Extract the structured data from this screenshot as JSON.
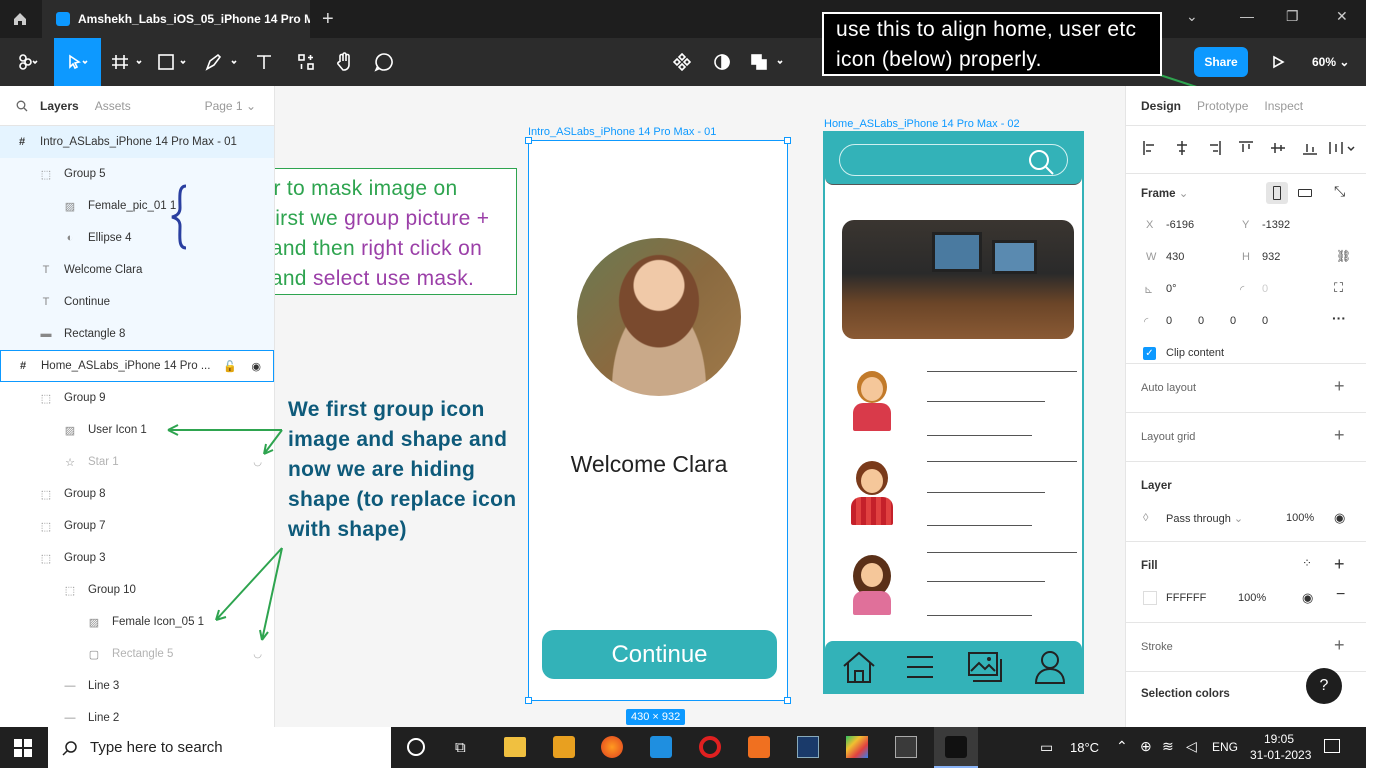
{
  "tabbar": {
    "file_tab": "Amshekh_Labs_iOS_05_iPhone 14 Pro M",
    "close": "✕",
    "new_tab": "+"
  },
  "toolbar": {
    "share_label": "Share",
    "zoom": "60%",
    "present_icon": "play-icon"
  },
  "left_panel": {
    "tabs": [
      "Layers",
      "Assets"
    ],
    "page_select": "Page 1",
    "layers": [
      {
        "name": "Intro_ASLabs_iPhone 14 Pro Max - 01",
        "icon": "frame-icon"
      },
      {
        "name": "Group 5",
        "icon": "group-icon"
      },
      {
        "name": "Female_pic_01 1",
        "icon": "image-icon"
      },
      {
        "name": "Ellipse 4",
        "icon": "mask-icon"
      },
      {
        "name": "Welcome Clara",
        "icon": "text-icon"
      },
      {
        "name": "Continue",
        "icon": "text-icon"
      },
      {
        "name": "Rectangle 8",
        "icon": "rectangle-icon"
      },
      {
        "name": "Home_ASLabs_iPhone 14 Pro ...",
        "icon": "frame-icon"
      },
      {
        "name": "Group 9",
        "icon": "group-icon"
      },
      {
        "name": "User Icon 1",
        "icon": "image-icon"
      },
      {
        "name": "Star 1",
        "icon": "star-icon"
      },
      {
        "name": "Group 8",
        "icon": "group-icon"
      },
      {
        "name": "Group 7",
        "icon": "group-icon"
      },
      {
        "name": "Group 3",
        "icon": "group-icon"
      },
      {
        "name": "Group 10",
        "icon": "group-icon"
      },
      {
        "name": "Female Icon_05 1",
        "icon": "image-icon"
      },
      {
        "name": "Rectangle 5",
        "icon": "rectangle-icon"
      },
      {
        "name": "Line 3",
        "icon": "line-icon"
      },
      {
        "name": "Line 2",
        "icon": "line-icon"
      }
    ]
  },
  "canvas": {
    "frame1_label": "Intro_ASLabs_iPhone 14 Pro Max - 01",
    "frame2_label": "Home_ASLabs_iPhone 14 Pro Max - 02",
    "welcome_text": "Welcome  Clara",
    "continue_label": "Continue",
    "size_badge": "430 × 932"
  },
  "annotations": {
    "top": "use this to align home, user etc icon (below) properly.",
    "mask": {
      "p1": "In order to mask image on circle, first we ",
      "h1": "group picture + shape",
      "p2": " and then ",
      "h2": "right click on shape",
      "p3": " and ",
      "h3": "select use mask."
    },
    "hiding": "We first group icon image and shape and now we are hiding shape (to replace icon with shape)"
  },
  "right_panel": {
    "tabs": [
      "Design",
      "Prototype",
      "Inspect"
    ],
    "frame_label": "Frame",
    "x_label": "X",
    "x": "-6196",
    "y_label": "Y",
    "y": "-1392",
    "w_label": "W",
    "w": "430",
    "h_label": "H",
    "h": "932",
    "rotation": "0°",
    "corner": "0",
    "corners": [
      "0",
      "0",
      "0",
      "0"
    ],
    "clip_content": "Clip content",
    "auto_layout": "Auto layout",
    "layout_grid": "Layout grid",
    "layer_title": "Layer",
    "blend": "Pass through",
    "layer_opacity": "100%",
    "fill_title": "Fill",
    "fill_hex": "FFFFFF",
    "fill_opacity": "100%",
    "stroke_title": "Stroke",
    "selection_colors": "Selection colors",
    "help": "?"
  },
  "taskbar": {
    "search_placeholder": "Type here to search",
    "temp": "18°C",
    "lang": "ENG",
    "time": "19:05",
    "date": "31-01-2023"
  },
  "colors": {
    "accent": "#0d99ff",
    "teal": "#33b2b8",
    "annotation_green": "#2ea44f",
    "annotation_purple": "#9b3fa8",
    "annotation_blue": "#0e5a7a"
  }
}
